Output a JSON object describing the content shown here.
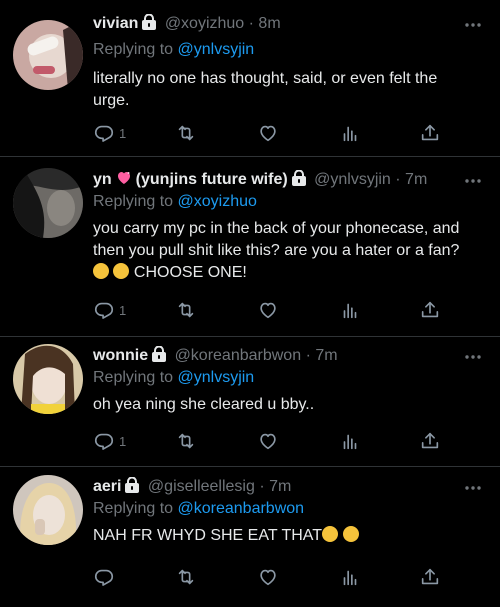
{
  "tweets": [
    {
      "name": "vivian",
      "handle": "@xoyizhuo",
      "time": "· 8m",
      "replying_label": "Replying to",
      "replying_to": "@ynlvsyjin",
      "text": "literally no one has thought, said, or even felt the urge.",
      "reply_count": "1",
      "avatar_colors": [
        "#c9a8a2",
        "#f2ede9",
        "#3a2a28"
      ]
    },
    {
      "name": "yn",
      "name_suffix": "(yunjins future wife)",
      "handle": "@ynlvsyjin",
      "time": "· 7m",
      "replying_label": "Replying to",
      "replying_to": "@xoyizhuo",
      "text_line1": "you carry my pc in the back of your phonecase, and",
      "text_line2": "then you pull shit like this? are you a hater or a fan?",
      "text_line3": "CHOOSE ONE!",
      "reply_count": "1",
      "avatar_colors": [
        "#3a3a3a",
        "#7a7772",
        "#151515"
      ]
    },
    {
      "name": "wonnie",
      "handle": "@koreanbarbwon",
      "time": "· 7m",
      "replying_label": "Replying to",
      "replying_to": "@ynlvsyjin",
      "text": "oh yea ning she cleared u bby..",
      "reply_count": "1",
      "avatar_colors": [
        "#d8c9a8",
        "#e9d6c8",
        "#4a3322"
      ]
    },
    {
      "name": "aeri",
      "handle": "@giselleellesig",
      "time": "· 7m",
      "replying_label": "Replying to",
      "replying_to": "@koreanbarbwon",
      "text": "NAH FR WHYD SHE EAT THAT",
      "reply_count": "",
      "avatar_colors": [
        "#cfc6bd",
        "#e8dfd6",
        "#8a7a6a"
      ]
    }
  ],
  "colors": {
    "background": "#000000",
    "text": "#e7e9ea",
    "muted": "#71767b",
    "link": "#1d9bf0",
    "divider": "#2f3336"
  }
}
